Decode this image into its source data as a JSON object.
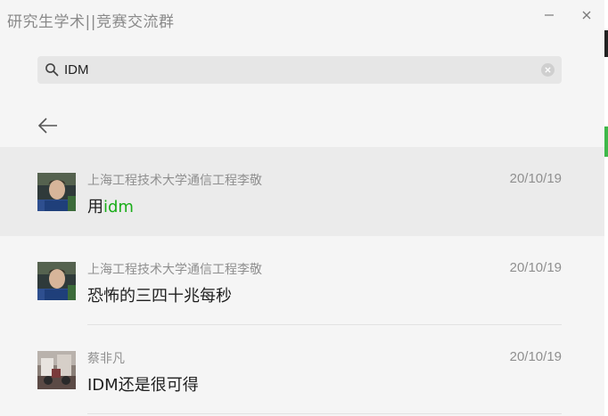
{
  "window": {
    "title": "研究生学术||竞赛交流群"
  },
  "search": {
    "value": "IDM"
  },
  "results": [
    {
      "sender": "上海工程技术大学通信工程李敬",
      "date": "20/10/19",
      "message_before": "用",
      "message_match": "idm",
      "message_after": "",
      "avatar": "person-photo-avatar",
      "selected": true
    },
    {
      "sender": "上海工程技术大学通信工程李敬",
      "date": "20/10/19",
      "message_before": "恐怖的三四十兆每秒",
      "message_match": "",
      "message_after": "",
      "avatar": "person-photo-avatar",
      "selected": false
    },
    {
      "sender": "蔡非凡",
      "date": "20/10/19",
      "message_before": "IDM还是很可得",
      "message_match": "",
      "message_after": "",
      "avatar": "photo-avatar",
      "selected": false
    }
  ],
  "colors": {
    "highlight": "#1aad19",
    "background": "#f5f5f5",
    "selected_row": "#ebebeb"
  }
}
